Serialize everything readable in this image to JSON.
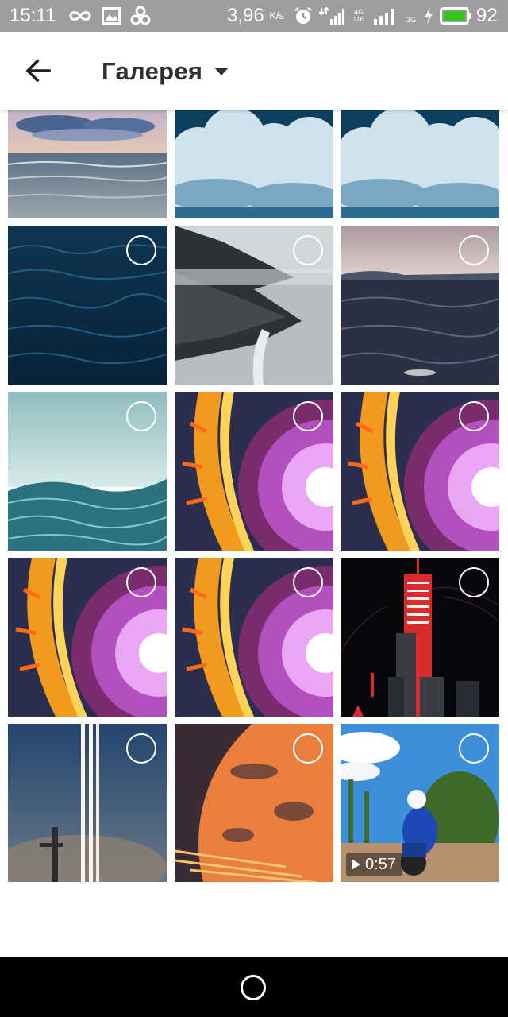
{
  "status_bar": {
    "time": "15:11",
    "speed": "3,96",
    "speed_unit": "K/s",
    "network_4g": "4G",
    "network_lte": "LTE",
    "network_3g": "3G",
    "battery": "92",
    "icons": [
      "infinity-icon",
      "image-icon",
      "pinwheel-icon",
      "alarm-icon",
      "signal-icon",
      "signal-icon",
      "charging-icon",
      "battery-icon"
    ],
    "battery_color": "#35c41e"
  },
  "app_bar": {
    "title": "Галерея",
    "back_icon": "arrow-left-icon",
    "dropdown_icon": "caret-down-icon"
  },
  "gallery": {
    "items": [
      {
        "kind": "image",
        "subject": "ocean-sunset"
      },
      {
        "kind": "image",
        "subject": "clouds"
      },
      {
        "kind": "image",
        "subject": "clouds"
      },
      {
        "kind": "image",
        "subject": "dark-sea-waves"
      },
      {
        "kind": "image",
        "subject": "foggy-coast"
      },
      {
        "kind": "image",
        "subject": "sea-at-dusk"
      },
      {
        "kind": "image",
        "subject": "teal-sea"
      },
      {
        "kind": "image",
        "subject": "fire-portal"
      },
      {
        "kind": "image",
        "subject": "fire-portal"
      },
      {
        "kind": "image",
        "subject": "fire-portal"
      },
      {
        "kind": "image",
        "subject": "fire-portal"
      },
      {
        "kind": "image",
        "subject": "neon-city-tower"
      },
      {
        "kind": "image",
        "subject": "rocket-launch"
      },
      {
        "kind": "image",
        "subject": "orange-planet"
      },
      {
        "kind": "video",
        "subject": "motocross-rider",
        "duration": "0:57"
      }
    ]
  },
  "nav_bar": {
    "home_icon": "home-circle-icon"
  }
}
